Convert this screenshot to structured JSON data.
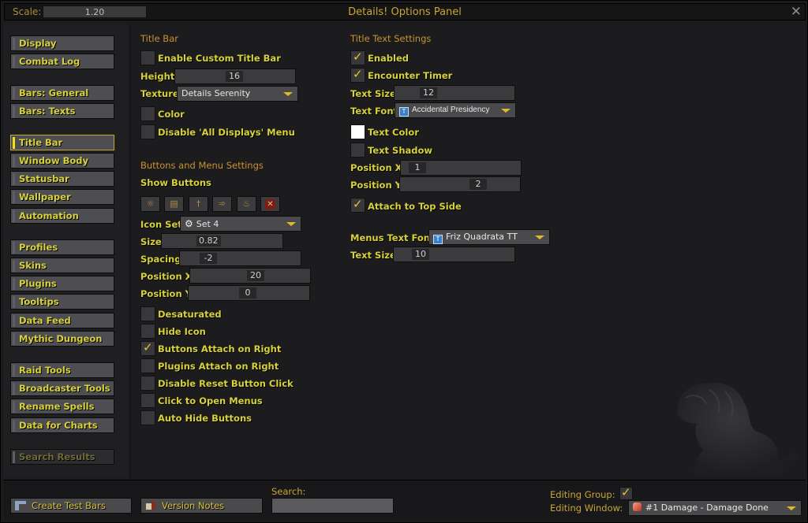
{
  "header": {
    "scale_label": "Scale:",
    "scale_value": "1.20",
    "title": "Details! Options Panel",
    "close_icon": "close-icon"
  },
  "sidebar": {
    "groups": [
      [
        {
          "label": "Display"
        },
        {
          "label": "Combat Log"
        }
      ],
      [
        {
          "label": "Bars: General"
        },
        {
          "label": "Bars: Texts"
        }
      ],
      [
        {
          "label": "Title Bar",
          "active": true
        },
        {
          "label": "Window Body"
        },
        {
          "label": "Statusbar"
        },
        {
          "label": "Wallpaper"
        },
        {
          "label": "Automation"
        }
      ],
      [
        {
          "label": "Profiles"
        },
        {
          "label": "Skins"
        },
        {
          "label": "Plugins"
        },
        {
          "label": "Tooltips"
        },
        {
          "label": "Data Feed"
        },
        {
          "label": "Mythic Dungeon"
        }
      ],
      [
        {
          "label": "Raid Tools"
        },
        {
          "label": "Broadcaster Tools"
        },
        {
          "label": "Rename Spells"
        },
        {
          "label": "Data for Charts"
        }
      ]
    ],
    "search_results": "Search Results"
  },
  "title_bar": {
    "section": "Title Bar",
    "enable_custom": {
      "label": "Enable Custom Title Bar",
      "checked": false
    },
    "height": {
      "label": "Height",
      "value": "16"
    },
    "texture": {
      "label": "Texture",
      "value": "Details Serenity"
    },
    "color": {
      "label": "Color",
      "checked": false
    },
    "disable_all_displays": {
      "label": "Disable 'All Displays' Menu",
      "checked": false
    }
  },
  "buttons_menu": {
    "section": "Buttons and Menu Settings",
    "show_buttons": "Show Buttons",
    "button_icons": [
      "gear-icon",
      "document-icon",
      "sword-icon",
      "arrow-icon",
      "reset-icon",
      "close-icon"
    ],
    "icon_set": {
      "label": "Icon Set",
      "value": "Set 4"
    },
    "size": {
      "label": "Size",
      "value": "0.82"
    },
    "spacing": {
      "label": "Spacing",
      "value": "-2"
    },
    "position_x": {
      "label": "Position X",
      "value": "20"
    },
    "position_y": {
      "label": "Position Y",
      "value": "0"
    },
    "options": [
      {
        "label": "Desaturated",
        "checked": false
      },
      {
        "label": "Hide Icon",
        "checked": false
      },
      {
        "label": "Buttons Attach on Right",
        "checked": true
      },
      {
        "label": "Plugins Attach on Right",
        "checked": false
      },
      {
        "label": "Disable Reset Button Click",
        "checked": false
      },
      {
        "label": "Click to Open Menus",
        "checked": false
      },
      {
        "label": "Auto Hide Buttons",
        "checked": false
      }
    ]
  },
  "title_text": {
    "section": "Title Text Settings",
    "enabled": {
      "label": "Enabled",
      "checked": true
    },
    "encounter_timer": {
      "label": "Encounter Timer",
      "checked": true
    },
    "text_size": {
      "label": "Text Size",
      "value": "12"
    },
    "text_font": {
      "label": "Text Font",
      "value": "Accidental Presidency"
    },
    "text_color": {
      "label": "Text Color",
      "color": "#ffffff"
    },
    "text_shadow": {
      "label": "Text Shadow",
      "checked": false
    },
    "position_x": {
      "label": "Position X",
      "value": "1"
    },
    "position_y": {
      "label": "Position Y",
      "value": "2"
    },
    "attach_top": {
      "label": "Attach to Top Side",
      "checked": true
    },
    "menus_font": {
      "label": "Menus Text Font",
      "value": "Friz Quadrata TT"
    },
    "menus_size": {
      "label": "Text Size",
      "value": "10"
    }
  },
  "footer": {
    "create_test_bars": "Create Test Bars",
    "version_notes": "Version Notes",
    "search_label": "Search:",
    "search_value": "",
    "editing_group_label": "Editing Group:",
    "editing_group_checked": true,
    "editing_window_label": "Editing Window:",
    "editing_window_value": "#1 Damage - Damage Done"
  },
  "colors": {
    "accent_yellow": "#d7d13a",
    "section_orange": "#c9922e",
    "title_gold": "#c9a538"
  }
}
